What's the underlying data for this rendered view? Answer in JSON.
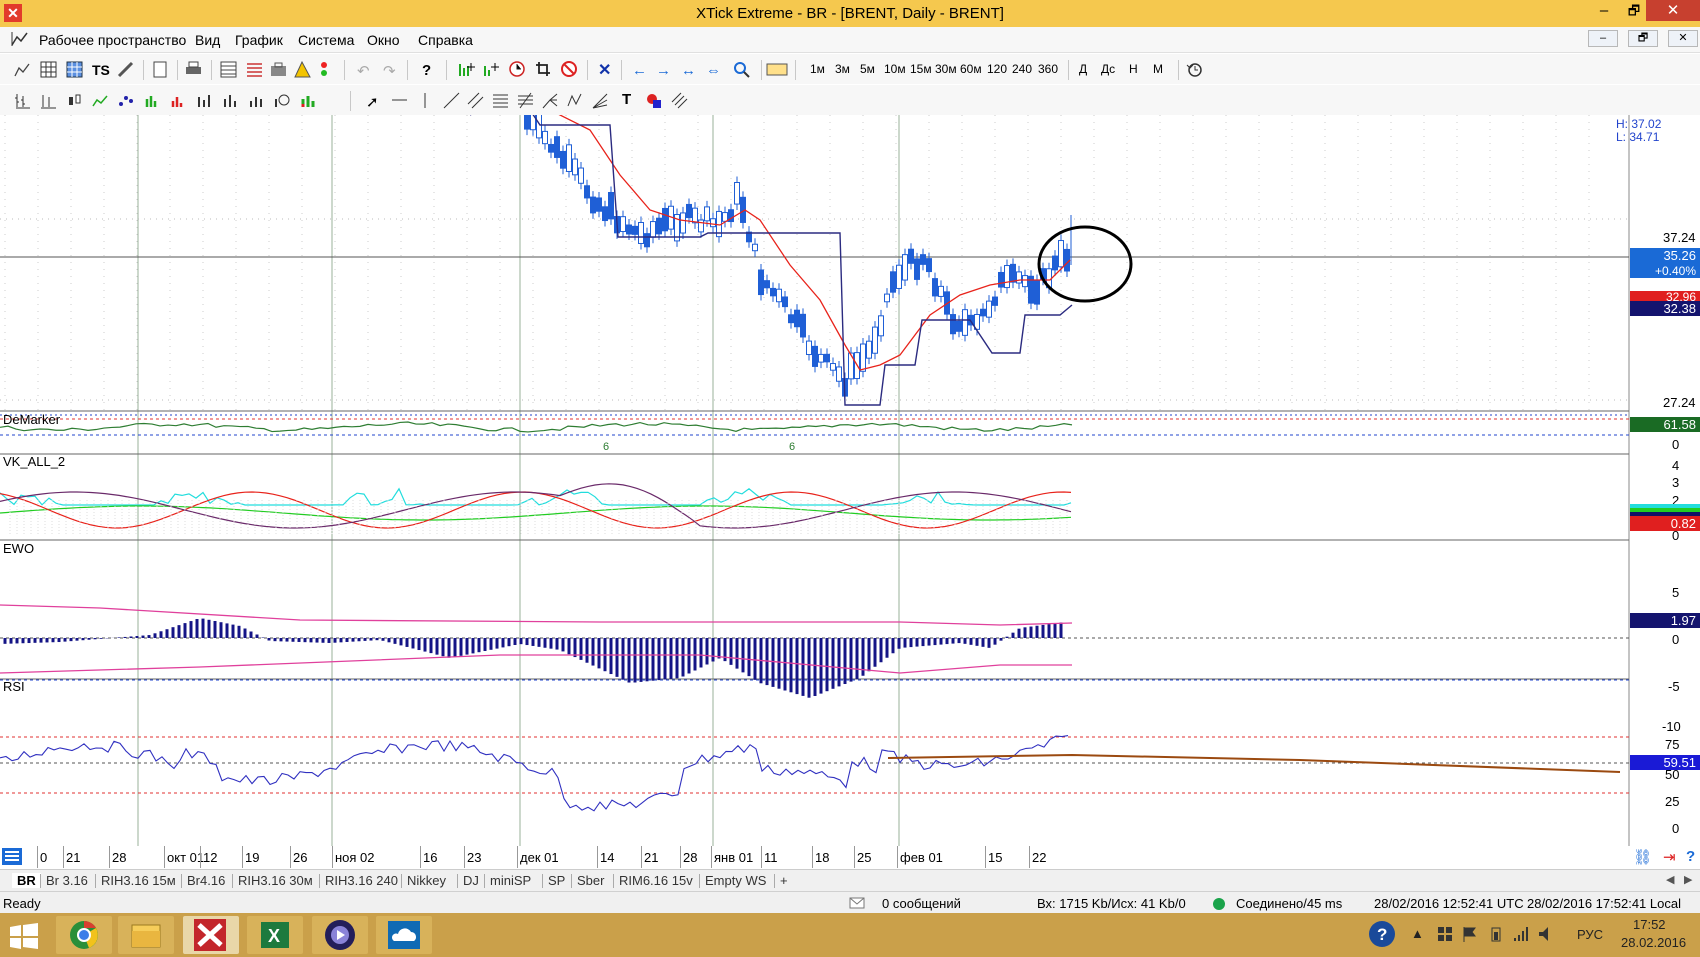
{
  "window": {
    "title": "XTick Extreme - BR - [BRENT, Daily - BRENT]",
    "minimize": "–",
    "maximize": "🗗",
    "close": "✕"
  },
  "menu": {
    "items": [
      "Рабочее пространство",
      "Вид",
      "График",
      "Система",
      "Окно",
      "Справка"
    ],
    "mdi": [
      "–",
      "🗗",
      "✕"
    ]
  },
  "toolbar1": {
    "timeframes": [
      "1м",
      "3м",
      "5м",
      "10м",
      "15м",
      "30м",
      "60м",
      "120",
      "240",
      "360",
      "Д",
      "Дс",
      "Н",
      "М"
    ]
  },
  "chart": {
    "hl_high": "H: 37.02",
    "hl_low": "L: 34.71",
    "price_labels": [
      "37.24",
      "27.24"
    ],
    "badges": {
      "last": "35.26",
      "change": "+0.40%",
      "red": "32.96",
      "navy": "32.38"
    },
    "panels": {
      "demarker": "DeMarker",
      "vk": "VK_ALL_2",
      "ewo": "EWO",
      "rsi": "RSI"
    },
    "demarker_badge": "61.58",
    "demarker_axis": [
      "0"
    ],
    "demarker_marks": [
      "6",
      "6"
    ],
    "vk_axis": [
      "4",
      "3",
      "2",
      "0"
    ],
    "vk_badge": "0.82",
    "ewo_axis": [
      "5",
      "0",
      "-5",
      "-10"
    ],
    "ewo_badge": "1.97",
    "rsi_axis": [
      "75",
      "50",
      "25",
      "0"
    ],
    "rsi_badge": "59.51"
  },
  "colors": {
    "candle": "#1f5fd6",
    "sma": "#e8231b",
    "channel": "#2b2b80",
    "demarker": "#2e7d32",
    "ewo_bar": "#141486",
    "ewo_band": "#e0409c",
    "rsi": "#3030c0",
    "rsi_trend": "#9b4a10",
    "titlebar": "#f5c84e"
  },
  "dates": [
    "0",
    "21",
    "28",
    "окт 01",
    "12",
    "19",
    "26",
    "ноя 02",
    "16",
    "23",
    "дек 01",
    "14",
    "21",
    "28",
    "янв 01",
    "11",
    "18",
    "25",
    "фев 01",
    "15",
    "22"
  ],
  "tabs": [
    "BR",
    "Br 3.16",
    "RIH3.16 15м",
    "Br4.16",
    "RIH3.16 30м",
    "RIH3.16 240",
    "Nikkey",
    "DJ",
    "miniSP",
    "SP",
    "Sber",
    "RIM6.16 15v",
    "Empty WS",
    "+"
  ],
  "status": {
    "ready": "Ready",
    "messages": "0 сообщений",
    "traffic": "Вх: 1715 Kb/Исх: 41 Kb/0",
    "connected": "Соединено/45 ms",
    "utc": "28/02/2016 12:52:41 UTC",
    "local": "28/02/2016 17:52:41 Local"
  },
  "taskbar": {
    "lang": "РУС",
    "time": "17:52",
    "date": "28.02.2016"
  }
}
